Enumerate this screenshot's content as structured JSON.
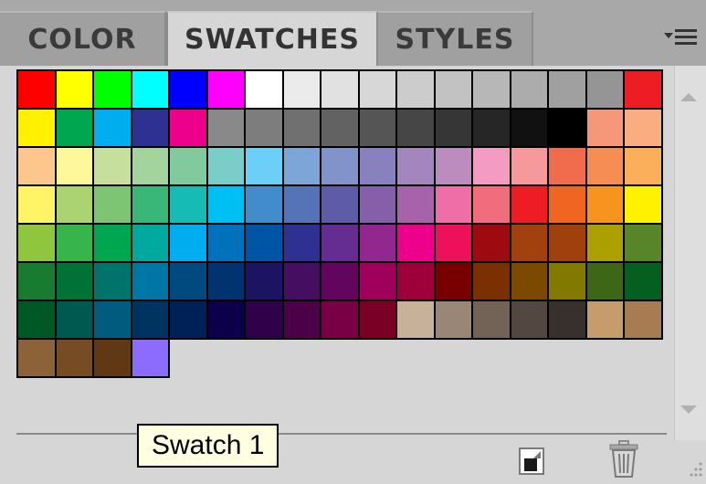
{
  "tabs": [
    {
      "label": "COLOR",
      "active": false
    },
    {
      "label": "SWATCHES",
      "active": true
    },
    {
      "label": "STYLES",
      "active": false
    }
  ],
  "menu_icon": "panel-menu-icon",
  "swatches": {
    "rows": [
      [
        "#ff0000",
        "#ffff00",
        "#00ff00",
        "#00ffff",
        "#0000ff",
        "#ff00ff",
        "#ffffff",
        "#ebebeb",
        "#e1e1e1",
        "#d7d7d7",
        "#cccccc",
        "#c2c2c2",
        "#b7b7b7",
        "#acacac",
        "#a0a0a0",
        "#959595",
        "#ee1d24"
      ],
      [
        "#fff100",
        "#00a650",
        "#00aeef",
        "#2f3192",
        "#ec008c",
        "#898989",
        "#7d7d7d",
        "#707070",
        "#626262",
        "#555555",
        "#464646",
        "#363636",
        "#262626",
        "#111111",
        "#000000",
        "#f7977a",
        "#fbad82"
      ],
      [
        "#fdc68c",
        "#fff799",
        "#c6df9c",
        "#a4d49d",
        "#81ca9d",
        "#7bcdc9",
        "#6ccff7",
        "#7ca6d8",
        "#8293ca",
        "#8881be",
        "#a286bd",
        "#bc8cbf",
        "#f49bc1",
        "#f5999d",
        "#f16c4d",
        "#f68e54",
        "#fbaf5a"
      ],
      [
        "#fff467",
        "#acd372",
        "#7dc473",
        "#39b778",
        "#16bcb4",
        "#00bff3",
        "#438ccb",
        "#5573b7",
        "#5e5ca7",
        "#855fa8",
        "#a763a9",
        "#ef6ea8",
        "#f16d7e",
        "#ee1d24",
        "#f16522",
        "#f7941d",
        "#fff100"
      ],
      [
        "#8fc63d",
        "#37b44a",
        "#00a650",
        "#00a99e",
        "#00aeef",
        "#0072bc",
        "#0054a5",
        "#2f3192",
        "#652c91",
        "#91278f",
        "#ed008c",
        "#ee105a",
        "#9d0a0f",
        "#a1410d",
        "#a0410d",
        "#aba000",
        "#588528"
      ],
      [
        "#197b30",
        "#007236",
        "#00736a",
        "#0076a4",
        "#004a80",
        "#003370",
        "#1d1363",
        "#450e61",
        "#62055f",
        "#9e005c",
        "#9d0039",
        "#790000",
        "#7b3000",
        "#7c4900",
        "#827a00",
        "#3e6617",
        "#045f20"
      ],
      [
        "#005824",
        "#005951",
        "#005b7e",
        "#003460",
        "#002157",
        "#0c004b",
        "#30004a",
        "#4b0048",
        "#7a0045",
        "#7a0026",
        "#c7b299",
        "#998675",
        "#736357",
        "#534741",
        "#37302d",
        "#c69c6d",
        "#a67c52"
      ],
      [
        "#8c6239",
        "#754c24",
        "#603813",
        "#8c6cff"
      ]
    ]
  },
  "tooltip": {
    "text": "Swatch 1"
  },
  "bottom_icons": [
    "new-swatch-icon",
    "trash-icon"
  ]
}
